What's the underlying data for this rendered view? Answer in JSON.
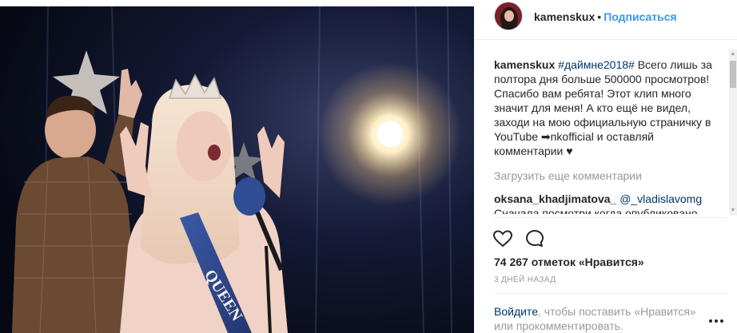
{
  "post": {
    "username": "kamenskux",
    "dot": "•",
    "follow_label": "Подписаться"
  },
  "caption": {
    "username": "kamenskux",
    "hashtag": "#даймне2018#",
    "text": "Всего лишь за полтора дня больше 500000 просмотров! Спасибо вам ребята! Этот клип много значит для меня! А кто ещё не видел, заходи на мою официальную страничку в YouTube ➡nkofficial и оставляй комментарии ♥"
  },
  "load_more_label": "Загрузить еще комментарии",
  "comment": {
    "username": "oksana_khadjimatova_",
    "mention": "@_vladislavomg",
    "text": "Сначала посмотри когда опубликовано"
  },
  "actions": {
    "like_icon": "heart-icon",
    "comment_icon": "speech-bubble-icon"
  },
  "likes_text": "74 267 отметок «Нравится»",
  "timestamp": "3 ДНЕЙ НАЗАД",
  "login_prompt": {
    "link": "Войдите",
    "rest": ", чтобы поставить «Нравится» или прокомментировать."
  },
  "photo": {
    "sash_text": "QUEEN"
  },
  "colors": {
    "link_blue": "#3897f0",
    "hashtag_blue": "#003569",
    "muted": "#999999"
  }
}
